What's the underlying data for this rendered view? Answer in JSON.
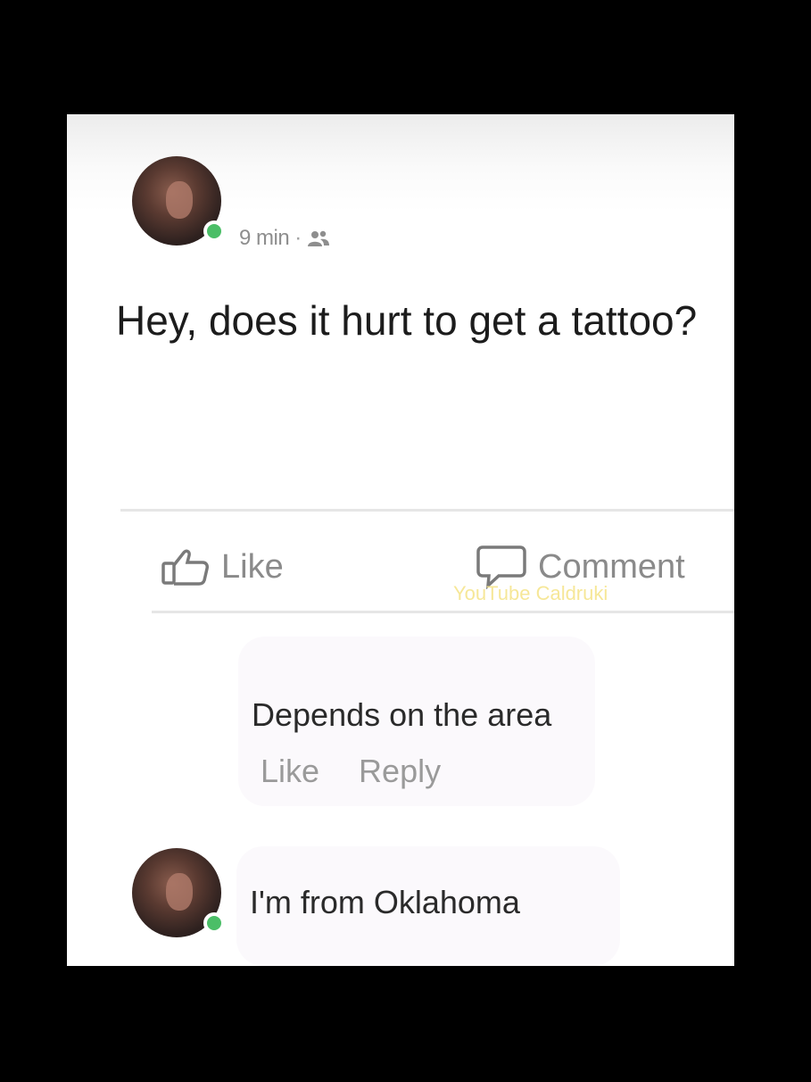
{
  "post": {
    "time": "9 min",
    "separator": "·",
    "audience_icon": "friends-icon",
    "text": "Hey, does it hurt to get a tattoo?"
  },
  "actions": {
    "like_label": "Like",
    "like_icon": "thumbs-up-icon",
    "comment_label": "Comment",
    "comment_icon": "speech-bubble-icon"
  },
  "watermark": "YouTube Caldruki",
  "comments": [
    {
      "text": "Depends on the area",
      "like_label": "Like",
      "reply_label": "Reply"
    }
  ],
  "reply": {
    "text": "I'm from Oklahoma"
  },
  "colors": {
    "online_indicator": "#4bbe67",
    "watermark": "#f6e58d"
  }
}
